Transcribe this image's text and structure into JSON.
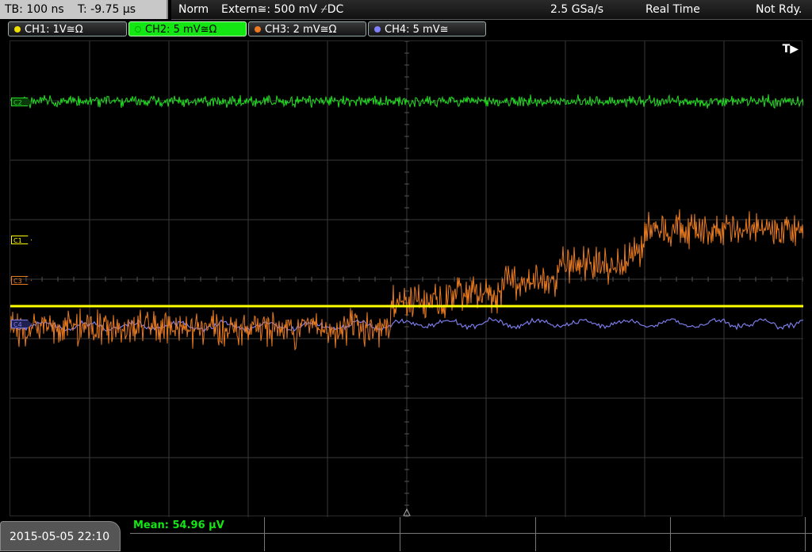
{
  "header": {
    "timebase": "TB: 100 ns",
    "trigger_time": "T: -9.75 µs",
    "mode": "Norm",
    "trigger_source": "Extern≅: 500 mV ⌿DC",
    "sample_rate": "2.5 GSa/s",
    "acquisition": "Real Time",
    "status": "Not Rdy."
  },
  "channels": [
    {
      "label": "CH1: 1V≅Ω",
      "color": "#f0e000"
    },
    {
      "label": "CH2: 5 mV≅Ω",
      "color": "#14e614"
    },
    {
      "label": "CH3: 2 mV≅Ω",
      "color": "#f07820"
    },
    {
      "label": "CH4: 5 mV≅",
      "color": "#8080ff"
    }
  ],
  "markers": {
    "c1": "C1",
    "c2": "C2",
    "c3": "C3",
    "c4": "C4",
    "trigger": "T▶"
  },
  "colors": {
    "ch1": "#ffff00",
    "ch2": "#22dd22",
    "ch3": "#e87a20",
    "ch4": "#7b7bea",
    "grid": "#3a3a3a"
  },
  "footer": {
    "datetime": "2015-05-05 22:10",
    "measurement": "Mean: 54.96 µV"
  }
}
